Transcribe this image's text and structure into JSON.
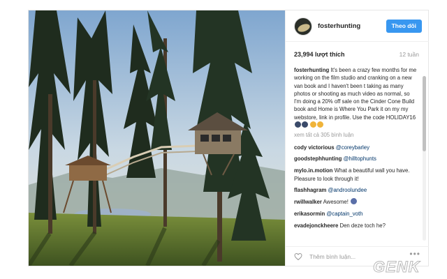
{
  "post": {
    "username": "fosterhunting",
    "follow_label": "Theo dõi",
    "likes": "23,994 lượt thích",
    "time_ago": "12 tuần",
    "caption_user": "fosterhunting",
    "caption_text": "It's been a crazy few months for me working on the film studio and cranking on a new van book and I haven't been t taking as many photos or shooting as much video as normal, so I'm doing a 20% off sale on the Cinder Cone Build book and Home is Where You Park it on my my webstore, link in profile. Use the code HOLIDAY16",
    "view_all": "xem tất cả 305 bình luận",
    "comments": [
      {
        "user": "cody victorious",
        "text": "@coreybarley",
        "mention": true
      },
      {
        "user": "goodstephhunting",
        "text": "@hilltophunts",
        "mention": true
      },
      {
        "user": "mylo.in.motion",
        "text": "What a beautiful wall you have. Pleasure to look through it!",
        "mention": false
      },
      {
        "user": "flashhagram",
        "text": "@androolundee",
        "mention": true
      },
      {
        "user": "rwillwalker",
        "text": "Awesome!",
        "mention": false
      },
      {
        "user": "erikasormin",
        "text": "@captain_voth",
        "mention": true
      },
      {
        "user": "evadejonckheere",
        "text": "Den deze toch he?",
        "mention": false
      }
    ],
    "add_comment_placeholder": "Thêm bình luận...",
    "more_label": "•••"
  },
  "watermark": {
    "text": "GENK"
  },
  "icons": [
    "heart-icon",
    "more-options-icon",
    "avatar",
    "emoji-icon"
  ],
  "colors": {
    "follow_button": "#3897f0",
    "text": "#262626",
    "muted": "#999999",
    "mention": "#003569"
  }
}
